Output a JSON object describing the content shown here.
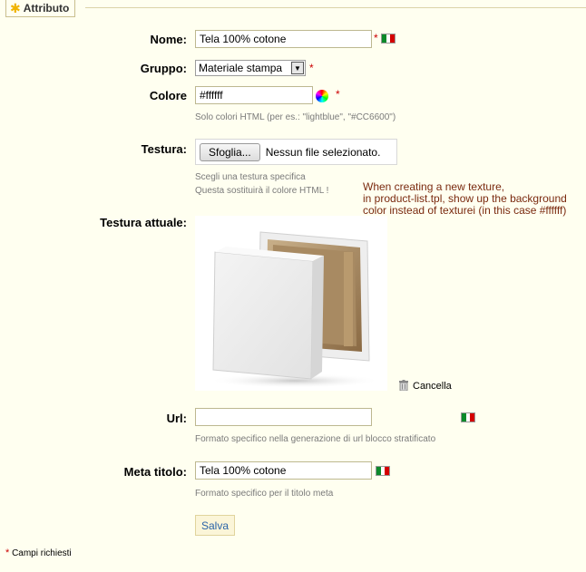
{
  "section": {
    "title": "Attributo"
  },
  "fields": {
    "nome": {
      "label": "Nome:",
      "value": "Tela 100% cotone",
      "required_mark": "*"
    },
    "gruppo": {
      "label": "Gruppo:",
      "selected": "Materiale stampa",
      "required_mark": "*"
    },
    "colore": {
      "label": "Colore",
      "value": "#ffffff",
      "required_mark": "*",
      "hint": "Solo colori HTML (per es.: \"lightblue\", \"#CC6600\")"
    },
    "testura": {
      "label": "Testura:",
      "browse_button": "Sfoglia...",
      "file_status": "Nessun file selezionato.",
      "hint_line1": "Scegli una testura specifica",
      "hint_line2": "Questa sostituirà il colore HTML !"
    },
    "testura_attuale": {
      "label": "Testura attuale:",
      "delete_label": "Cancella"
    },
    "url": {
      "label": "Url:",
      "value": "",
      "hint": "Formato specifico nella generazione di url blocco stratificato"
    },
    "meta_titolo": {
      "label": "Meta titolo:",
      "value": "Tela 100% cotone",
      "hint": "Formato specifico per il titolo meta"
    }
  },
  "annotation": {
    "line1": "When creating a new texture,",
    "line2": "in product-list.tpl, show up the background",
    "line3": "color instead of texturei (in this case #ffffff)"
  },
  "actions": {
    "save_label": "Salva"
  },
  "footer": {
    "required_mark": "*",
    "required_note": "Campi richiesti"
  },
  "colors": {
    "background": "#fffff0",
    "annotation": "#7a2a0f",
    "required": "#cc0000",
    "link": "#2a63a8"
  }
}
